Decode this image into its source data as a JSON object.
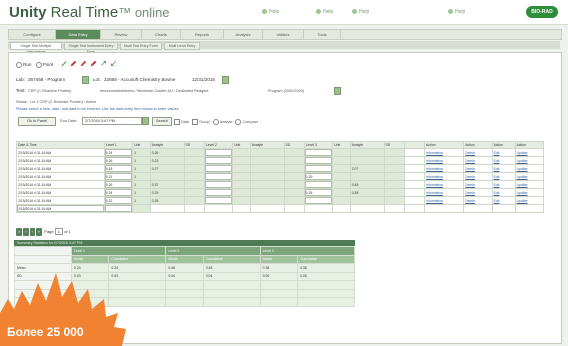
{
  "app": {
    "title": "Unity Real Time online",
    "title_bold": "Unity",
    "title_rest": "Real Time",
    "title_suffix": "online",
    "brand": "BIO-RAD"
  },
  "header": {
    "links": [
      "Help",
      "Help",
      "Help",
      "Help"
    ]
  },
  "menu": {
    "items": [
      "Configure",
      "Data Entry",
      "Review",
      "Charts",
      "Reports",
      "Analysis",
      "Utilities",
      "Tools"
    ],
    "active": 1
  },
  "subtabs": {
    "items": [
      "Single Test Multiple Instruments",
      "Single Test Instrument Entry Form",
      "Multi Test Entry Form",
      "Multi Level Entry"
    ],
    "active": 0
  },
  "form": {
    "mode_options": [
      "Run",
      "Point"
    ],
    "lab_label": "Lab:",
    "lab_value": "267468 - Program",
    "lot_label": "Lot:",
    "lot_value": "22668 - Accusoft Chemistry Bovine",
    "lot_expiry": "12/31/2015",
    "test_label": "Test:",
    "test_value": "CRP (C-Reactive Protein)",
    "method_text": "Immunoturbidimetric / Beckman Coulter AU / Dedicated Reagent",
    "program_text": "Program (2000/2000)",
    "status_label": "Status:",
    "status_text": "Lot 1 CRP (C-Reactive Protein) / Active",
    "note_text": "Please select a time, date, and data to be entered. Use the data entry form below to enter values.",
    "run_btn": "Go to Panel",
    "date_label": "Run Date:",
    "date_value": "2/7/2016  3:47 PM",
    "search_btn": "Search",
    "options": [
      "Date",
      "Group",
      "Analyte",
      "Compact"
    ]
  },
  "grid": {
    "headers": [
      "Date & Time",
      "Level 1",
      "Unit",
      "Analyte",
      "SD",
      "Level 2",
      "Unit",
      "Analyte",
      "SD",
      "Level 3",
      "Unit",
      "Analyte",
      "SD",
      "",
      "Action",
      "Action",
      "Action",
      "Action"
    ],
    "rows": [
      {
        "date": "2/15/2016 4:31:16 AM",
        "l1": "0.24",
        "u1": "1",
        "a1": "0.26",
        "l2": "",
        "a2": "",
        "l3": "",
        "a3": "",
        "act": [
          "Information",
          "Delete",
          "Edit",
          "Update"
        ]
      },
      {
        "date": "2/15/2016 4:31:16 AM",
        "l1": "0.26",
        "u1": "1",
        "a1": "0.23",
        "l2": "",
        "a2": "",
        "l3": "",
        "a3": "",
        "act": [
          "Information",
          "Delete",
          "Edit",
          "Update"
        ]
      },
      {
        "date": "2/15/2016 4:31:16 AM",
        "l1": "0.18",
        "u1": "1",
        "a1": "0.27",
        "l2": "",
        "a2": "",
        "l3": "",
        "a3": "2.07",
        "act": [
          "Information",
          "Delete",
          "Edit",
          "Update"
        ]
      },
      {
        "date": "2/15/2016 4:31:16 AM",
        "l1": "0.21",
        "u1": "1",
        "a1": "",
        "l2": "",
        "a2": "",
        "l3": "0.29",
        "a3": "",
        "act": [
          "Information",
          "Delete",
          "Edit",
          "Update"
        ]
      },
      {
        "date": "2/15/2016 4:31:16 AM",
        "l1": "0.26",
        "u1": "1",
        "a1": "0.37",
        "l2": "",
        "a2": "",
        "l3": "",
        "a3": "0.48",
        "act": [
          "Information",
          "Delete",
          "Edit",
          "Update"
        ]
      },
      {
        "date": "2/15/2016 4:31:16 AM",
        "l1": "0.24",
        "u1": "1",
        "a1": "0.25",
        "l2": "",
        "a2": "",
        "l3": "0.25",
        "a3": "0.38",
        "act": [
          "Information",
          "Delete",
          "Edit",
          "Update"
        ]
      },
      {
        "date": "2/15/2016 4:31:16 AM",
        "l1": "0.22",
        "u1": "1",
        "a1": "0.28",
        "l2": "",
        "a2": "",
        "l3": "",
        "a3": "",
        "act": [
          "Information",
          "Delete",
          "Edit",
          "Update"
        ]
      },
      {
        "date": "2/15/2016 4:31:16 AM",
        "l1": "",
        "u1": "",
        "a1": "",
        "l2": "",
        "a2": "",
        "l3": "",
        "a3": "",
        "act": [
          "",
          "",
          "",
          ""
        ]
      }
    ]
  },
  "pager": {
    "label": "Page",
    "page": "1",
    "of": "of 1"
  },
  "summary": {
    "title": "Summary Statistics for 2/7/2016 3:47 PM",
    "groups": [
      "Level 1",
      "Level 2",
      "Level 3"
    ],
    "subheads": [
      "Month",
      "Cumulative",
      "Month",
      "Cumulative",
      "Month",
      "Cumulative"
    ],
    "rows": [
      {
        "label": "",
        "vals": [
          "",
          "",
          "",
          "",
          "",
          ""
        ]
      },
      {
        "label": "Mean",
        "vals": [
          "0.24",
          "0.24",
          "0.48",
          "0.48",
          "0.38",
          "0.38"
        ]
      },
      {
        "label": "SD",
        "vals": [
          "0.03",
          "0.03",
          "0.04",
          "0.04",
          "0.05",
          "0.05"
        ]
      },
      {
        "label": "",
        "vals": [
          "",
          "",
          "",
          "",
          "",
          ""
        ]
      },
      {
        "label": "",
        "vals": [
          "",
          "",
          "",
          "",
          "",
          ""
        ]
      },
      {
        "label": "",
        "vals": [
          "",
          "",
          "",
          "",
          "",
          ""
        ]
      }
    ]
  },
  "promo": {
    "text": "Более 25 000",
    "color": "#f08232"
  }
}
